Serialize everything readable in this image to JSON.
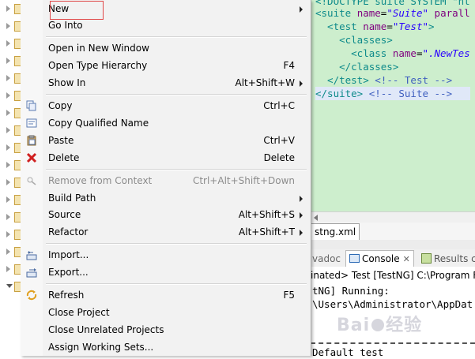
{
  "menu": {
    "items": [
      {
        "label": "New",
        "shortcut": "",
        "submenu": true,
        "disabled": false,
        "icon": ""
      },
      {
        "label": "Go Into",
        "shortcut": "",
        "submenu": false,
        "disabled": false,
        "icon": ""
      },
      {
        "label": "Open in New Window",
        "shortcut": "",
        "submenu": false,
        "disabled": false,
        "icon": ""
      },
      {
        "label": "Open Type Hierarchy",
        "shortcut": "F4",
        "submenu": false,
        "disabled": false,
        "icon": ""
      },
      {
        "label": "Show In",
        "shortcut": "Alt+Shift+W",
        "submenu": true,
        "disabled": false,
        "icon": ""
      },
      {
        "label": "Copy",
        "shortcut": "Ctrl+C",
        "submenu": false,
        "disabled": false,
        "icon": "copy-icon"
      },
      {
        "label": "Copy Qualified Name",
        "shortcut": "",
        "submenu": false,
        "disabled": false,
        "icon": "copy-qualified-name-icon"
      },
      {
        "label": "Paste",
        "shortcut": "Ctrl+V",
        "submenu": false,
        "disabled": false,
        "icon": "paste-icon"
      },
      {
        "label": "Delete",
        "shortcut": "Delete",
        "submenu": false,
        "disabled": false,
        "icon": "delete-icon"
      },
      {
        "label": "Remove from Context",
        "shortcut": "Ctrl+Alt+Shift+Down",
        "submenu": false,
        "disabled": true,
        "icon": "remove-from-context-icon"
      },
      {
        "label": "Build Path",
        "shortcut": "",
        "submenu": true,
        "disabled": false,
        "icon": ""
      },
      {
        "label": "Source",
        "shortcut": "Alt+Shift+S",
        "submenu": true,
        "disabled": false,
        "icon": ""
      },
      {
        "label": "Refactor",
        "shortcut": "Alt+Shift+T",
        "submenu": true,
        "disabled": false,
        "icon": ""
      },
      {
        "label": "Import...",
        "shortcut": "",
        "submenu": false,
        "disabled": false,
        "icon": "import-icon"
      },
      {
        "label": "Export...",
        "shortcut": "",
        "submenu": false,
        "disabled": false,
        "icon": "export-icon"
      },
      {
        "label": "Refresh",
        "shortcut": "F5",
        "submenu": false,
        "disabled": false,
        "icon": "refresh-icon"
      },
      {
        "label": "Close Project",
        "shortcut": "",
        "submenu": false,
        "disabled": false,
        "icon": ""
      },
      {
        "label": "Close Unrelated Projects",
        "shortcut": "",
        "submenu": false,
        "disabled": false,
        "icon": ""
      },
      {
        "label": "Assign Working Sets...",
        "shortcut": "",
        "submenu": false,
        "disabled": false,
        "icon": ""
      }
    ],
    "highlight_color": "#e04848"
  },
  "editor": {
    "lines": [
      {
        "tag_open": "<!DOCTYPE suite SYSTEM \"ht",
        "attr": "",
        "eq": "",
        "val": "",
        "tail": "",
        "comment": ""
      },
      {
        "tag_open": "<suite ",
        "attr": "name",
        "eq": "=",
        "val": "\"Suite\"",
        "tail": " parall",
        "comment": ""
      },
      {
        "tag_open": "  <test ",
        "attr": "name",
        "eq": "=",
        "val": "\"Test\"",
        "tail": ">",
        "comment": ""
      },
      {
        "tag_open": "    <classes>",
        "attr": "",
        "eq": "",
        "val": "",
        "tail": "",
        "comment": ""
      },
      {
        "tag_open": "      <class ",
        "attr": "name",
        "eq": "=",
        "val": "\".NewTes",
        "tail": "",
        "comment": ""
      },
      {
        "tag_open": "    </classes>",
        "attr": "",
        "eq": "",
        "val": "",
        "tail": "",
        "comment": ""
      },
      {
        "tag_open": "  </test> ",
        "attr": "",
        "eq": "",
        "val": "",
        "tail": "",
        "comment": "<!-- Test -->"
      },
      {
        "tag_open": "</suite> ",
        "attr": "",
        "eq": "",
        "val": "",
        "tail": "",
        "comment": "<!-- Suite -->"
      }
    ],
    "background": "#cdeecd",
    "tab_label": "stng.xml"
  },
  "views": {
    "tab_javadoc": "vadoc",
    "tab_console": "Console",
    "tab_console_close": "✕",
    "tab_results": "Results c"
  },
  "console": {
    "header": "inated> Test [TestNG] C:\\Program F",
    "lines": [
      "tNG] Running:",
      "\\Users\\Administrator\\AppDat",
      "",
      "Default test"
    ]
  },
  "watermark": {
    "left": "Bai",
    "right": "经验"
  }
}
